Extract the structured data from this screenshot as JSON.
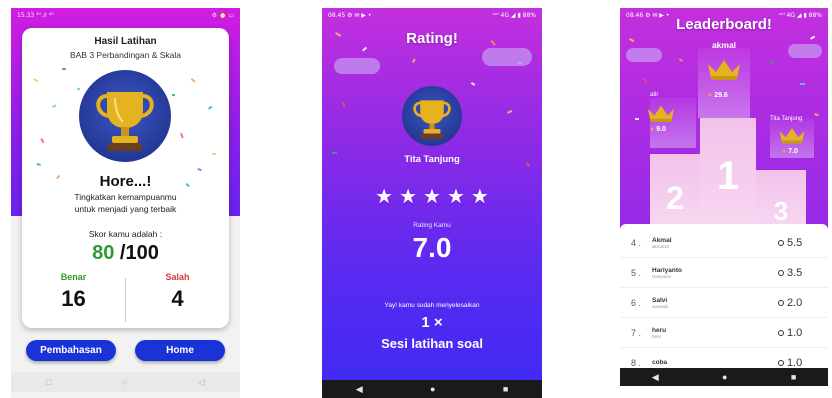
{
  "result_screen": {
    "status_time": "15.33",
    "status_left": "15.33 ⁴ᴳ.ıl ⁴ᴳ",
    "status_right": "⚙ ⏰ ▭",
    "title": "Hasil Latihan",
    "subtitle": "BAB 3 Perbandingan & Skala",
    "hore": "Hore...!",
    "motivation_line1": "Tingkatkan kemampuanmu",
    "motivation_line2": "untuk menjadi yang terbaik",
    "score_label": "Skor kamu adalah :",
    "score": "80",
    "score_max": " /100",
    "correct_label": "Benar",
    "correct_count": "16",
    "wrong_label": "Salah",
    "wrong_count": "4",
    "discussion_button": "Pembahasan",
    "home_button": "Home",
    "nav": [
      "□",
      "○",
      "◁"
    ]
  },
  "rating_screen": {
    "status_left": "08.45 ⚙ ✉ ▶ •",
    "status_right": "ᵛᵒˡ 4G ◢ ▮ 88%",
    "title": "Rating!",
    "name": "Tita Tanjung",
    "stars": [
      "★",
      "★",
      "★",
      "★",
      "★"
    ],
    "rating_label": "Rating Kamu",
    "rating_value": "7.0",
    "done_text": "Yay! kamu sudah menyelesaikan",
    "times": "1 ×",
    "session_text": "Sesi latihan soal",
    "nav": [
      "◀",
      "●",
      "■"
    ]
  },
  "leaderboard_screen": {
    "status_left": "08.46 ⚙ ✉ ▶ •",
    "status_right": "ᵛᵒˡ 4G ◢ ▮ 88%",
    "title": "Leaderboard!",
    "first": {
      "name": "akmal",
      "score": "29.6",
      "place": "1"
    },
    "second": {
      "name": "atir",
      "score": "9.0",
      "place": "2"
    },
    "third": {
      "name": "Tita Tanjung",
      "score": "7.0",
      "place": "3"
    },
    "rows": [
      {
        "rank": "4 .",
        "name": "Akmal",
        "username": "akmal10",
        "score": "5.5"
      },
      {
        "rank": "5 .",
        "name": "Hariyanto",
        "username": "Hariyanto",
        "score": "3.5"
      },
      {
        "rank": "6 .",
        "name": "Salvi",
        "username": "wawaaii",
        "score": "2.0"
      },
      {
        "rank": "7 .",
        "name": "heru",
        "username": "heru",
        "score": "1.0"
      },
      {
        "rank": "8 .",
        "name": "coba",
        "username": "",
        "score": "1.0"
      }
    ],
    "nav": [
      "◀",
      "●",
      "■"
    ]
  },
  "colors": {
    "purple_top": "#c42fde",
    "blue_bottom": "#3c2bf4",
    "button_blue": "#1a33d6",
    "correct_green": "#2e9b2e",
    "wrong_red": "#d63a3a",
    "gold": "#e5b320"
  }
}
